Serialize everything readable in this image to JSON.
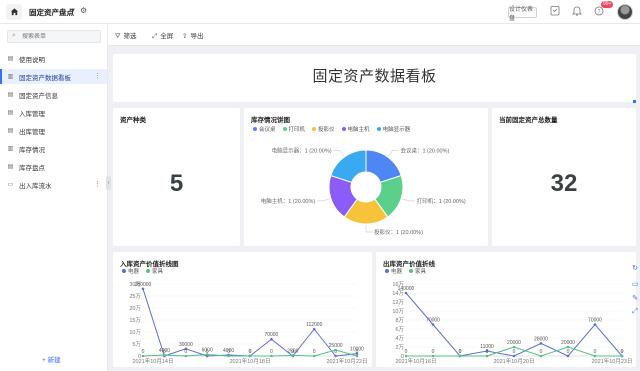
{
  "header": {
    "app_title": "固定资产盘点",
    "set_form_button": "设计仪表盘",
    "notification_badge": "99+"
  },
  "sidebar": {
    "search_placeholder": "搜索表单",
    "items": [
      {
        "label": "使用说明",
        "icon": "doc-icon",
        "active": false
      },
      {
        "label": "固定资产数据看板",
        "icon": "dashboard-icon",
        "active": true
      },
      {
        "label": "固定资产信息",
        "icon": "form-icon",
        "active": false
      },
      {
        "label": "入库管理",
        "icon": "form-icon",
        "active": false
      },
      {
        "label": "出库管理",
        "icon": "form-icon",
        "active": false
      },
      {
        "label": "库存情况",
        "icon": "report-icon",
        "active": false
      },
      {
        "label": "库存盘点",
        "icon": "form-icon",
        "active": false
      },
      {
        "label": "出入库流水",
        "icon": "folder-icon",
        "active": false
      }
    ],
    "new_button": "+ 新建"
  },
  "toolbar": {
    "filter": "筛选",
    "expand": "全屏",
    "export": "导出"
  },
  "banner": {
    "title": "固定资产数据看板"
  },
  "cards": {
    "asset_types": {
      "title": "资产种类",
      "value": "5"
    },
    "stock_pie": {
      "title": "库存情况饼图"
    },
    "total_assets": {
      "title": "当前固定资产总数量",
      "value": "32"
    },
    "inbound_line": {
      "title": "入库资产价值折线图"
    },
    "outbound_line": {
      "title": "出库资产价值折线"
    }
  },
  "chart_data": [
    {
      "type": "pie",
      "title": "库存情况饼图",
      "categories": [
        "会议桌",
        "打印机",
        "投影仪",
        "电脑主机",
        "电脑显示器"
      ],
      "values": [
        1,
        1,
        1,
        1,
        1
      ],
      "slice_labels": [
        "会议桌：1 (20.00%)",
        "打印机：1 (20.00%)",
        "投影仪：1 (20.00%)",
        "电脑主机：1 (20.00%)",
        "电脑显示器：1 (20.00%)"
      ],
      "colors": [
        "#4e86f5",
        "#5ad08a",
        "#f7c33b",
        "#8b5cf6",
        "#39a9f2"
      ],
      "donut": true,
      "legend_position": "top"
    },
    {
      "type": "line",
      "title": "入库资产价值折线图",
      "x_tick_labels": [
        "2021年10月14日",
        "2021年10月18日",
        "2021年10月22日"
      ],
      "y_tick_labels": [
        "0",
        "5万",
        "10万",
        "15万",
        "20万",
        "25万",
        "30万"
      ],
      "ylim": [
        0,
        300000
      ],
      "x": [
        "p1",
        "p2",
        "p3",
        "p4",
        "p5",
        "p6",
        "p7",
        "p8",
        "p9",
        "p10",
        "p11"
      ],
      "series": [
        {
          "name": "电器",
          "color": "#5b6fd8",
          "values": [
            280000,
            0,
            30000,
            0,
            4000,
            0,
            70000,
            0,
            112000,
            0,
            10000
          ],
          "labels": [
            "280000",
            "0",
            "30000",
            "0",
            "4000",
            "0",
            "70000",
            "0",
            "112000",
            "0",
            "10000"
          ]
        },
        {
          "name": "家具",
          "color": "#55c27d",
          "values": [
            0,
            4000,
            0,
            6000,
            0,
            0,
            0,
            2500,
            0,
            25000,
            0
          ],
          "labels": [
            "0",
            "4000",
            "0",
            "6000",
            "0",
            "0",
            "0",
            "2500",
            "0",
            "25000",
            "0"
          ]
        }
      ],
      "legend_position": "top-left"
    },
    {
      "type": "line",
      "title": "出库资产价值折线",
      "x_tick_labels": [
        "2021年10月16日",
        "2021年10月20日",
        "2021年10月23日"
      ],
      "y_tick_labels": [
        "0",
        "2万",
        "4万",
        "6万",
        "8万",
        "10万",
        "12万",
        "14万",
        "16万"
      ],
      "ylim": [
        0,
        160000
      ],
      "x": [
        "p1",
        "p2",
        "p3",
        "p4",
        "p5",
        "p6",
        "p7",
        "p8",
        "p9"
      ],
      "series": [
        {
          "name": "电器",
          "color": "#5b6fd8",
          "values": [
            140000,
            70000,
            0,
            11000,
            0,
            28000,
            0,
            70000,
            0
          ],
          "labels": [
            "140000",
            "70000",
            "0",
            "11000",
            "0",
            "28000",
            "0",
            "70000",
            "0"
          ]
        },
        {
          "name": "家具",
          "color": "#55c27d",
          "values": [
            0,
            0,
            0,
            0,
            20000,
            0,
            20000,
            0,
            0
          ],
          "labels": [
            "0",
            "0",
            "0",
            "0",
            "20000",
            "0",
            "20000",
            "0",
            "0"
          ]
        }
      ],
      "legend_position": "top-left"
    }
  ]
}
